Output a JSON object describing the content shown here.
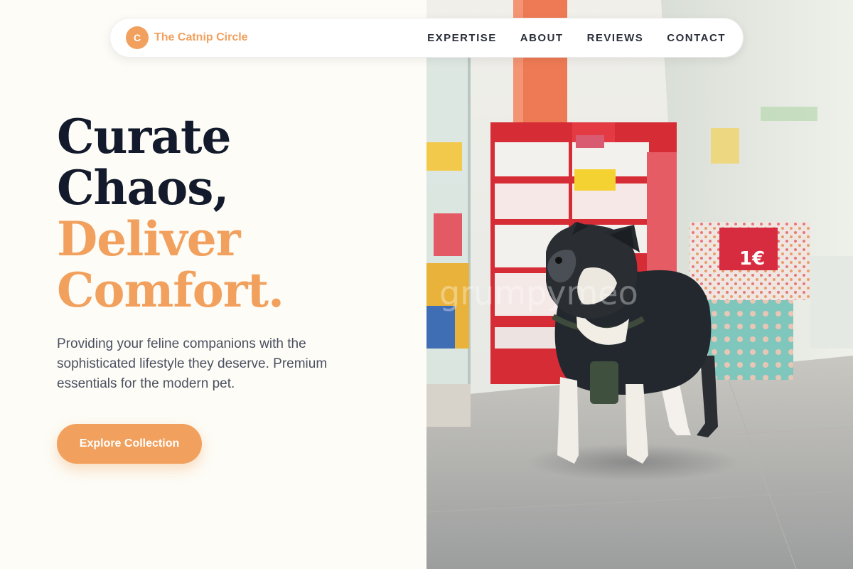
{
  "nav": {
    "logo_letter": "C",
    "brand_name": "The Catnip Circle",
    "links": [
      {
        "label": "EXPERTISE"
      },
      {
        "label": "ABOUT"
      },
      {
        "label": "REVIEWS"
      },
      {
        "label": "CONTACT"
      }
    ]
  },
  "hero": {
    "headline_line1": "Curate",
    "headline_line2": "Chaos,",
    "headline_accent_line1": "Deliver",
    "headline_accent_line2": "Comfort.",
    "subtext": "Providing your feline companions with the sophisticated lifestyle they deserve. Premium essentials for the modern pet.",
    "cta_label": "Explore Collection"
  },
  "photo": {
    "description_icon": "pet-store-photo",
    "price_tag": "1€",
    "watermark": "grumpymeo"
  },
  "colors": {
    "accent": "#F2A05D",
    "headline_dark": "#131A2B",
    "background": "#FDFCF6",
    "body_text": "#4A5060"
  }
}
